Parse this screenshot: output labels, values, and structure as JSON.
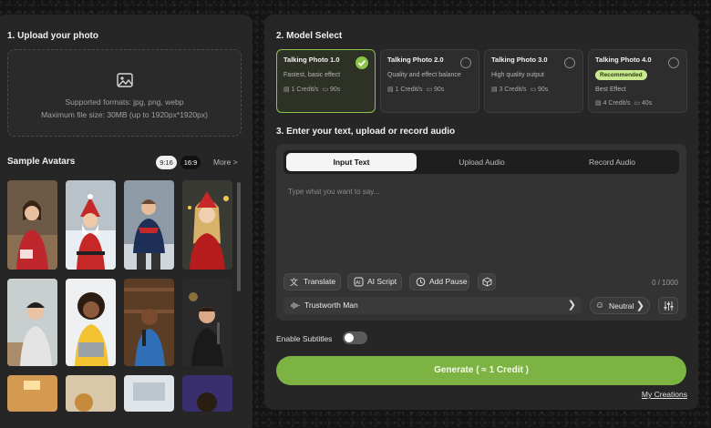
{
  "upload": {
    "title": "1. Upload your photo",
    "formats": "Supported formats: jpg, png, webp",
    "max_size": "Maximum file size: 30MB (up to 1920px*1920px)"
  },
  "samples": {
    "title": "Sample Avatars",
    "ratio_916": "9:16",
    "ratio_169": "16:9",
    "more": "More >"
  },
  "model": {
    "title": "2. Model Select",
    "cards": [
      {
        "name": "Talking Photo 1.0",
        "desc": "Fastest, basic effect",
        "credit": "1 Credit/s",
        "time": "90s",
        "selected": true
      },
      {
        "name": "Talking Photo 2.0",
        "desc": "Quality and effect balance",
        "credit": "1 Credit/s",
        "time": "90s"
      },
      {
        "name": "Talking Photo 3.0",
        "desc": "High quality output",
        "credit": "3 Credit/s",
        "time": "90s"
      },
      {
        "name": "Talking Photo 4.0",
        "badge": "Recommended",
        "desc": "Best Effect",
        "credit": "4 Credit/s",
        "time": "40s"
      }
    ]
  },
  "audio": {
    "title": "3. Enter your text, upload or record audio",
    "tabs": [
      "Input Text",
      "Upload Audio",
      "Record Audio"
    ],
    "placeholder": "Type what you want to say...",
    "translate": "Translate",
    "ai_script": "AI Script",
    "add_pause": "Add Pause",
    "counter": "0 / 1000",
    "voice": "Trustworth Man",
    "emotion": "Neutral"
  },
  "subtitles_label": "Enable Subtitles",
  "generate_label": "Generate ( ≈ 1 Credit )",
  "my_creations": "My Creations",
  "colors": {
    "accent": "#7cb342",
    "selected_border": "#8bc34a",
    "panel": "#262626"
  }
}
